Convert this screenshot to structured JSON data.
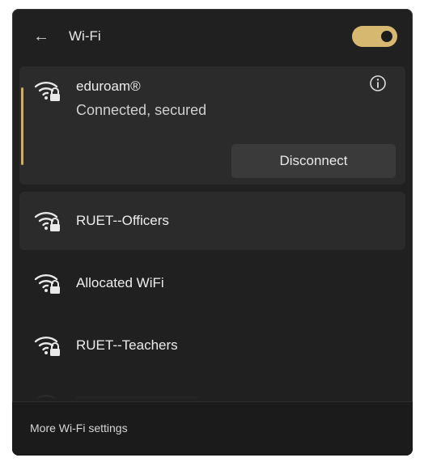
{
  "header": {
    "back_icon": "back-arrow-icon",
    "title": "Wi-Fi",
    "toggle_state": "on",
    "toggle_color": "#d7b871"
  },
  "networks": [
    {
      "name": "eduroam®",
      "status": "Connected, secured",
      "icon": "wifi-secured-icon",
      "info_icon": "info-icon",
      "action_label": "Disconnect",
      "expanded": true
    },
    {
      "name": "RUET--Officers",
      "icon": "wifi-secured-icon"
    },
    {
      "name": "Allocated WiFi",
      "icon": "wifi-secured-icon"
    },
    {
      "name": "RUET--Teachers",
      "icon": "wifi-secured-icon"
    }
  ],
  "footer": {
    "link_label": "More Wi-Fi settings"
  },
  "colors": {
    "accent": "#c9ad6b",
    "panel_bg": "#202020",
    "selected_bg": "#2b2b2b"
  }
}
